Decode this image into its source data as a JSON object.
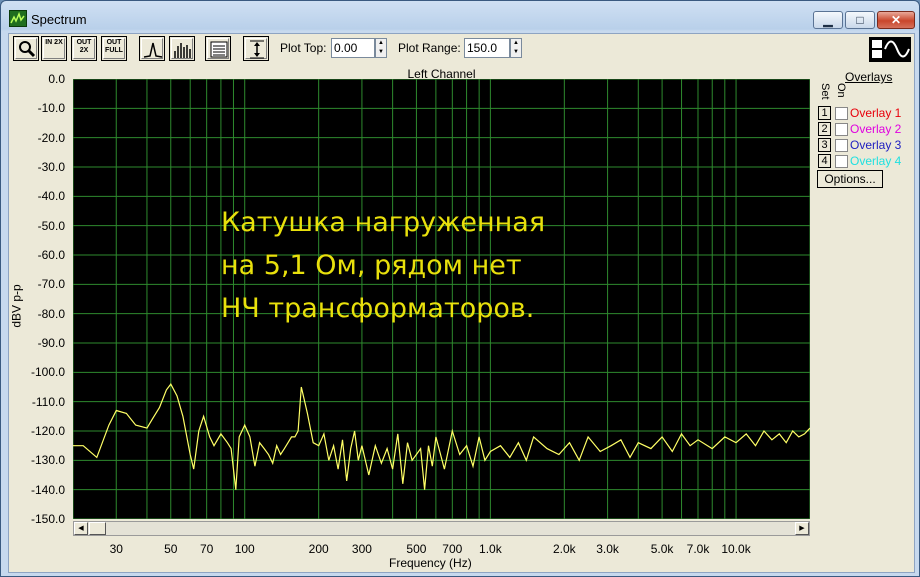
{
  "window": {
    "title": "Spectrum"
  },
  "toolbar": {
    "plot_top_label": "Plot Top:",
    "plot_top_value": "0.00",
    "plot_range_label": "Plot Range:",
    "plot_range_value": "150.0",
    "zoom_in_label": "IN 2X",
    "zoom_out_label": "OUT 2X",
    "zoom_full_label": "OUT FULL"
  },
  "overlays": {
    "title": "Overlays",
    "set_label": "Set",
    "on_label": "On",
    "items": [
      {
        "num": "1",
        "label": "Overlay 1",
        "color": "#e8000b"
      },
      {
        "num": "2",
        "label": "Overlay 2",
        "color": "#e000e0"
      },
      {
        "num": "3",
        "label": "Overlay 3",
        "color": "#2020c0"
      },
      {
        "num": "4",
        "label": "Overlay 4",
        "color": "#20e0e0"
      }
    ],
    "options_label": "Options..."
  },
  "annotation": {
    "line1": "Катушка нагруженная",
    "line2": "на 5,1 Ом, рядом нет",
    "line3": "НЧ трансформаторов."
  },
  "chart_data": {
    "type": "line",
    "title": "Left Channel",
    "xlabel": "Frequency (Hz)",
    "ylabel": "dBV p-p",
    "xscale": "log",
    "xlim": [
      20,
      20000
    ],
    "ylim": [
      -150,
      0
    ],
    "yticks": [
      "0.0",
      "-10.0",
      "-20.0",
      "-30.0",
      "-40.0",
      "-50.0",
      "-60.0",
      "-70.0",
      "-80.0",
      "-90.0",
      "-100.0",
      "-110.0",
      "-120.0",
      "-130.0",
      "-140.0",
      "-150.0"
    ],
    "xticks": [
      {
        "v": 30,
        "label": "30"
      },
      {
        "v": 50,
        "label": "50"
      },
      {
        "v": 70,
        "label": "70"
      },
      {
        "v": 100,
        "label": "100"
      },
      {
        "v": 200,
        "label": "200"
      },
      {
        "v": 300,
        "label": "300"
      },
      {
        "v": 500,
        "label": "500"
      },
      {
        "v": 700,
        "label": "700"
      },
      {
        "v": 1000,
        "label": "1.0k"
      },
      {
        "v": 2000,
        "label": "2.0k"
      },
      {
        "v": 3000,
        "label": "3.0k"
      },
      {
        "v": 5000,
        "label": "5.0k"
      },
      {
        "v": 7000,
        "label": "7.0k"
      },
      {
        "v": 10000,
        "label": "10.0k"
      }
    ],
    "grid": true,
    "background": "#000000",
    "grid_color": "#2e8a2e",
    "series": [
      {
        "color": "#ffff66",
        "x": [
          20,
          22,
          25,
          28,
          30,
          33,
          36,
          40,
          42,
          45,
          48,
          50,
          53,
          56,
          60,
          62,
          65,
          68,
          72,
          75,
          80,
          85,
          88,
          92,
          95,
          100,
          105,
          110,
          115,
          120,
          125,
          130,
          135,
          140,
          145,
          150,
          155,
          160,
          165,
          170,
          180,
          190,
          200,
          210,
          220,
          230,
          240,
          250,
          260,
          270,
          280,
          290,
          300,
          320,
          340,
          360,
          380,
          400,
          420,
          440,
          460,
          480,
          500,
          520,
          540,
          560,
          580,
          600,
          650,
          700,
          750,
          800,
          850,
          900,
          950,
          1000,
          1100,
          1200,
          1300,
          1400,
          1500,
          1700,
          1900,
          2100,
          2300,
          2500,
          2800,
          3100,
          3400,
          3700,
          4000,
          4500,
          5000,
          5500,
          6000,
          6500,
          7000,
          8000,
          9000,
          10000,
          11000,
          12000,
          13000,
          14000,
          15000,
          16000,
          17000,
          18000,
          19000,
          20000
        ],
        "y": [
          -125,
          -125,
          -129,
          -118,
          -113,
          -114,
          -118,
          -119,
          -116,
          -112,
          -106,
          -104,
          -108,
          -115,
          -128,
          -133,
          -120,
          -115,
          -122,
          -125,
          -121,
          -124,
          -126,
          -140,
          -122,
          -118,
          -122,
          -132,
          -124,
          -126,
          -128,
          -131,
          -125,
          -128,
          -126,
          -124,
          -122,
          -122,
          -120,
          -105,
          -114,
          -124,
          -125,
          -121,
          -130,
          -125,
          -133,
          -123,
          -137,
          -126,
          -120,
          -130,
          -125,
          -135,
          -125,
          -131,
          -126,
          -133,
          -121,
          -138,
          -124,
          -130,
          -128,
          -126,
          -140,
          -125,
          -132,
          -122,
          -133,
          -120,
          -128,
          -125,
          -132,
          -122,
          -130,
          -127,
          -125,
          -129,
          -124,
          -130,
          -122,
          -126,
          -128,
          -124,
          -130,
          -122,
          -127,
          -125,
          -123,
          -129,
          -124,
          -126,
          -122,
          -127,
          -121,
          -125,
          -123,
          -126,
          -122,
          -124,
          -121,
          -125,
          -120,
          -123,
          -121,
          -124,
          -120,
          -122,
          -121,
          -119
        ]
      }
    ]
  }
}
